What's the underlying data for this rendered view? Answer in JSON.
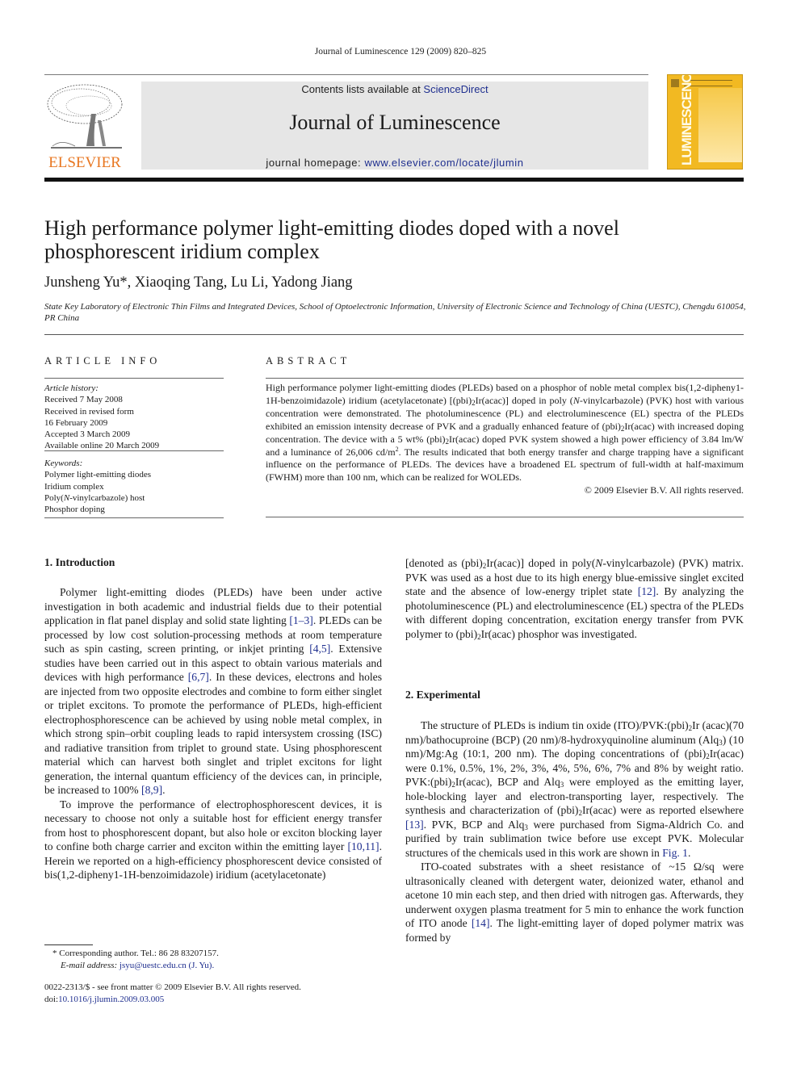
{
  "running_head": "Journal of Luminescence 129 (2009) 820–825",
  "header": {
    "publisher_logo_text": "ELSEVIER",
    "contents_prefix": "Contents lists available at ",
    "contents_link": "ScienceDirect",
    "journal_title": "Journal of Luminescence",
    "homepage_prefix": "journal homepage: ",
    "homepage_link": "www.elsevier.com/locate/jlumin",
    "cover_text": "LUMINESCENCE",
    "colors": {
      "banner_bg": "#e6e6e6",
      "link": "#1f2f8f",
      "elsevier_orange": "#e87722",
      "cover_yellow": "#f2b922"
    }
  },
  "article": {
    "title": "High performance polymer light-emitting diodes doped with a novel phosphorescent iridium complex",
    "authors": "Junsheng Yu",
    "authors_star": "*",
    "authors_rest": ", Xiaoqing Tang, Lu Li, Yadong Jiang",
    "affiliation": "State Key Laboratory of Electronic Thin Films and Integrated Devices, School of Optoelectronic Information, University of Electronic Science and Technology of China (UESTC), Chengdu 610054, PR China"
  },
  "article_info": {
    "heading": "ARTICLE INFO",
    "history_label": "Article history:",
    "history": [
      "Received 7 May 2008",
      "Received in revised form",
      "16 February 2009",
      "Accepted 3 March 2009",
      "Available online 20 March 2009"
    ],
    "keywords_label": "Keywords:",
    "keywords": [
      "Polymer light-emitting diodes",
      "Iridium complex",
      "Poly(",
      "N",
      "-vinylcarbazole) host",
      "Phosphor doping"
    ]
  },
  "abstract": {
    "heading": "ABSTRACT",
    "t1": "High performance polymer light-emitting diodes (PLEDs) based on a phosphor of noble metal complex bis(1,2-dipheny1-1H-benzoimidazole) iridium (acetylacetonate) [(pbi)",
    "t2": "Ir(acac)] doped in poly (",
    "t3": "-vinylcarbazole) (PVK) host with various concentration were demonstrated. The photoluminescence (PL) and electroluminescence (EL) spectra of the PLEDs exhibited an emission intensity decrease of PVK and a gradually enhanced feature of (pbi)",
    "t4": "Ir(acac) with increased doping concentration. The device with a 5 wt% (pbi)",
    "t5": "Ir(acac) doped PVK system showed a high power efficiency of 3.84 lm/W and a luminance of 26,006 cd/m",
    "t6": ". The results indicated that both energy transfer and charge trapping have a significant influence on the performance of PLEDs. The devices have a broadened EL spectrum of full-width at half-maximum (FWHM) more than 100 nm, which can be realized for WOLEDs.",
    "copyright": "© 2009 Elsevier B.V. All rights reserved.",
    "sub2": "2",
    "sup2": "2",
    "italic_n": "N"
  },
  "intro": {
    "heading": "1.  Introduction",
    "p1a": "Polymer light-emitting diodes (PLEDs) have been under active investigation in both academic and industrial fields due to their potential application in flat panel display and solid state lighting ",
    "ref1": "[1–3]",
    "p1b": ". PLEDs can be processed by low cost solution-processing methods at room temperature such as spin casting, screen printing, or inkjet printing ",
    "ref2": "[4,5]",
    "p1c": ". Extensive studies have been carried out in this aspect to obtain various materials and devices with high performance ",
    "ref3": "[6,7]",
    "p1d": ". In these devices, electrons and holes are injected from two opposite electrodes and combine to form either singlet or triplet excitons. To promote the performance of PLEDs, high-efficient electrophosphorescence can be achieved by using noble metal complex, in which strong spin–orbit coupling leads to rapid intersystem crossing (ISC) and radiative transition from triplet to ground state. Using phosphorescent material which can harvest both singlet and triplet excitons for light generation, the internal quantum efficiency of the devices can, in principle, be increased to 100% ",
    "ref4": "[8,9]",
    "p1e": ".",
    "p2a": "To improve the performance of electrophosphorescent devices, it is necessary to choose not only a suitable host for efficient energy transfer from host to phosphorescent dopant, but also hole or exciton blocking layer to confine both charge carrier and exciton within the emitting layer ",
    "ref5": "[10,11]",
    "p2b": ". Herein we reported on a high-efficiency phosphorescent device consisted of bis(1,2-dipheny1-1H-benzoimidazole) iridium (acetylacetonate)",
    "p3a": "[denoted as (pbi)",
    "p3b": "Ir(acac)] doped in poly(",
    "p3c": "-vinylcarbazole) (PVK) matrix. PVK was used as a host due to its high energy blue-emissive singlet excited state and the absence of low-energy triplet state ",
    "ref6": "[12]",
    "p3d": ". By analyzing the photoluminescence (PL) and electroluminescence (EL) spectra of the PLEDs with different doping concentration, excitation energy transfer from PVK polymer to (pbi)",
    "p3e": "Ir(acac) phosphor was investigated."
  },
  "experimental": {
    "heading": "2.  Experimental",
    "p1a": "The structure of PLEDs is indium tin oxide (ITO)/PVK:(pbi)",
    "p1b": "Ir (acac)(70 nm)/bathocuproine (BCP) (20 nm)/8-hydroxyquinoline aluminum (Alq",
    "p1c": ") (10 nm)/Mg:Ag (10:1, 200 nm). The doping concentrations of (pbi)",
    "p1d": "Ir(acac) were 0.1%, 0.5%, 1%, 2%, 3%, 4%, 5%, 6%, 7% and 8% by weight ratio. PVK:(pbi)",
    "p1e": "Ir(acac), BCP and Alq",
    "p1f": " were employed as the emitting layer, hole-blocking layer and electron-transporting layer, respectively. The synthesis and characterization of (pbi)",
    "p1g": "Ir(acac) were as reported elsewhere ",
    "ref1": "[13]",
    "p1h": ". PVK, BCP and Alq",
    "p1i": " were purchased from Sigma-Aldrich Co. and purified by train sublimation twice before use except PVK. Molecular structures of the chemicals used in this work are shown in ",
    "fig1": "Fig. 1",
    "p1j": ".",
    "p2a": "ITO-coated substrates with a sheet resistance of ~15 Ω/sq were ultrasonically cleaned with detergent water, deionized water, ethanol and acetone 10 min each step, and then dried with nitrogen gas. Afterwards, they underwent oxygen plasma treatment for 5 min to enhance the work function of ITO anode ",
    "ref2": "[14]",
    "p2b": ". The light-emitting layer of doped polymer matrix was formed by",
    "sub3": "3"
  },
  "footnote": {
    "star": "*",
    "corresponding": " Corresponding author. Tel.: 86 28 83207157.",
    "email_label": "E-mail address: ",
    "email": "jsyu@uestc.edu.cn",
    "email_name": " (J. Yu)."
  },
  "frontmatter": {
    "issn_line": "0022-2313/$ - see front matter © 2009 Elsevier B.V. All rights reserved.",
    "doi_prefix": "doi:",
    "doi": "10.1016/j.jlumin.2009.03.005"
  }
}
